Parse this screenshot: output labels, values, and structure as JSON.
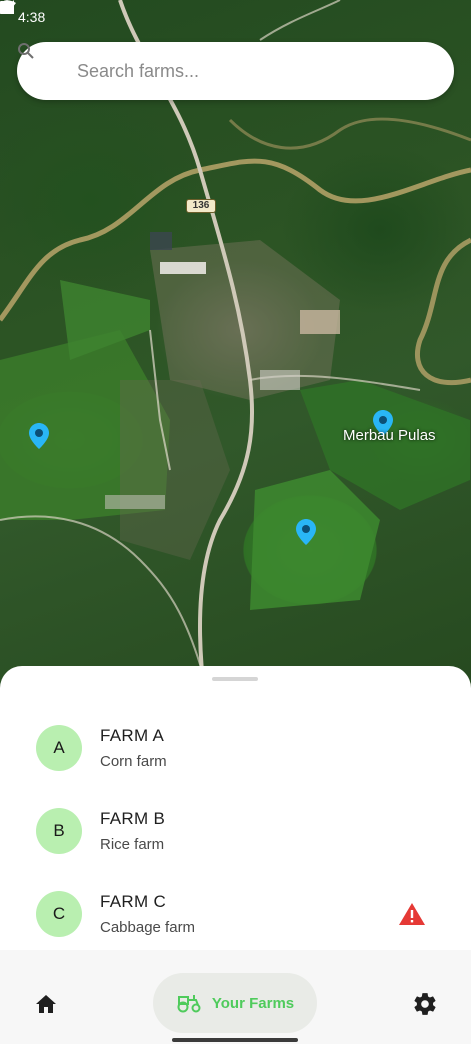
{
  "status_bar": {
    "time": "4:38"
  },
  "search": {
    "placeholder": "Search farms..."
  },
  "map": {
    "road_badge": "136",
    "place_label": "Merbau Pulas",
    "marker_color": "#29b6f6"
  },
  "farms": [
    {
      "initial": "A",
      "name": "FARM A",
      "type": "Corn farm",
      "alert": false
    },
    {
      "initial": "B",
      "name": "FARM B",
      "type": "Rice farm",
      "alert": false
    },
    {
      "initial": "C",
      "name": "FARM C",
      "type": "Cabbage farm",
      "alert": true
    }
  ],
  "nav": {
    "home_icon": "home-icon",
    "farms_label": "Your Farms",
    "farms_icon": "tractor-icon",
    "settings_icon": "gear-icon",
    "active_color": "#4fcb5c"
  },
  "colors": {
    "avatar_bg": "#b9efb0",
    "warning": "#e53935"
  }
}
